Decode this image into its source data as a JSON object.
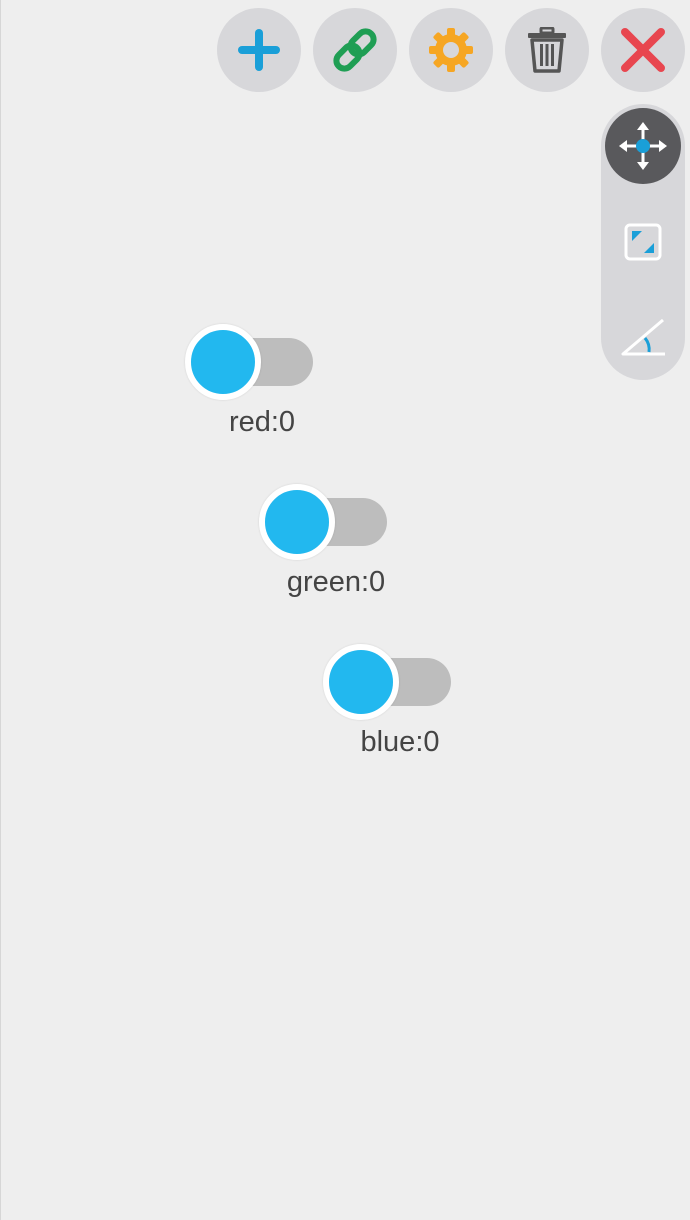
{
  "toolbar": {
    "buttons": [
      {
        "icon": "plus-icon",
        "color": "#1a9fd8"
      },
      {
        "icon": "link-icon",
        "color": "#1f9e54"
      },
      {
        "icon": "gear-icon",
        "color": "#f6a623"
      },
      {
        "icon": "trash-icon",
        "color": "#555555"
      },
      {
        "icon": "close-icon",
        "color": "#e8464f"
      }
    ]
  },
  "side_panel": {
    "tools": [
      {
        "icon": "move-arrows-icon",
        "active": true
      },
      {
        "icon": "scale-icon",
        "active": false
      },
      {
        "icon": "rotate-angle-icon",
        "active": false
      }
    ]
  },
  "toggles": [
    {
      "label": "red:0",
      "on": false
    },
    {
      "label": "green:0",
      "on": false
    },
    {
      "label": "blue:0",
      "on": false
    }
  ],
  "colors": {
    "accent": "#22b8ef",
    "track": "#bdbdbd",
    "button_bg": "#d7d7da",
    "active_tool_bg": "#59595c",
    "background": "#eeeeee"
  }
}
